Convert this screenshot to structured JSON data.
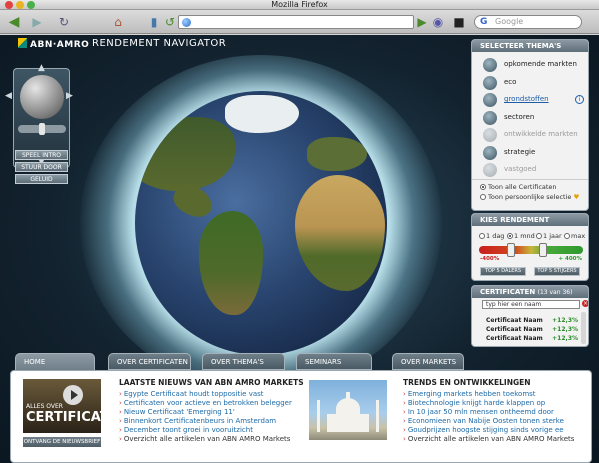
{
  "browser": {
    "window_title": "Mozilla Firefox",
    "search_placeholder": "Google"
  },
  "header": {
    "brand": "ABN·AMRO",
    "nav_title": "RENDEMENT NAVIGATOR"
  },
  "globe_controls": {
    "buttons": [
      "SPEEL INTRO",
      "STUUR DOOR",
      "GELUID"
    ]
  },
  "themes_panel": {
    "title": "SELECTEER THEMA'S",
    "items": [
      {
        "label": "opkomende markten",
        "state": "normal",
        "icon": "growth-icon"
      },
      {
        "label": "eco",
        "state": "normal",
        "icon": "leaf-icon"
      },
      {
        "label": "grondstoffen",
        "state": "link",
        "icon": "commodity-icon"
      },
      {
        "label": "sectoren",
        "state": "normal",
        "icon": "sector-icon"
      },
      {
        "label": "ontwikkelde markten",
        "state": "dim",
        "icon": "market-icon"
      },
      {
        "label": "strategie",
        "state": "normal",
        "icon": "strategy-icon"
      },
      {
        "label": "vastgoed",
        "state": "dim",
        "icon": "realestate-icon"
      }
    ],
    "info_icon": "info-icon",
    "radio_all": "Toon alle Certificaten",
    "radio_personal": "Toon persoonlijke selectie"
  },
  "return_panel": {
    "title": "KIES RENDEMENT",
    "periods": [
      "1 dag",
      "1 mnd",
      "1 jaar",
      "max"
    ],
    "selected_period": "1 mnd",
    "min_label": "-400%",
    "max_label": "+ 400%",
    "btn_fallers": "TOP 5 DALERS",
    "btn_risers": "TOP 5 STIJGERS"
  },
  "cert_panel": {
    "title": "CERTIFICATEN",
    "count": "(13 van 36)",
    "search_value": "typ hier een naam",
    "rows": [
      {
        "name": "Certificaat Naam",
        "value": "+12,3%"
      },
      {
        "name": "Certificaat Naam",
        "value": "+12,3%"
      },
      {
        "name": "Certificaat Naam",
        "value": "+12,3%"
      }
    ]
  },
  "tabs": [
    "HOME",
    "OVER CERTIFICATEN",
    "OVER THEMA'S",
    "SEMINARS",
    "OVER MARKETS"
  ],
  "promo": {
    "line1": "ALLES OVER",
    "line2": "CERTIFICATEN",
    "newsletter": "ONTVANG DE NIEUWSBRIEF"
  },
  "news": {
    "heading": "LAATSTE NIEUWS VAN ABN AMRO MARKETS",
    "items": [
      "Egypte Certificaat houdt toppositie vast",
      "Certificaten voor actieve en betrokken belegger",
      "Nieuw Certificaat 'Emerging 11'",
      "Binnenkort Certificatenbeurs in Amsterdam",
      "December toont groei in vooruitzicht",
      "Overzicht alle artikelen van ABN AMRO Markets"
    ]
  },
  "trends": {
    "heading": "TRENDS EN ONTWIKKELINGEN",
    "items": [
      "Emerging markets hebben toekomst",
      "Biotechnologie knijgt harde klappen op",
      "In 10 jaar 50 mln mensen ontheemd door",
      "Economieen van Nabije Oosten tonen sterke",
      "Goudprijzen hoogste stijging sinds vorige ee",
      "Overzicht alle artikelen van ABN AMRO Markets"
    ]
  }
}
